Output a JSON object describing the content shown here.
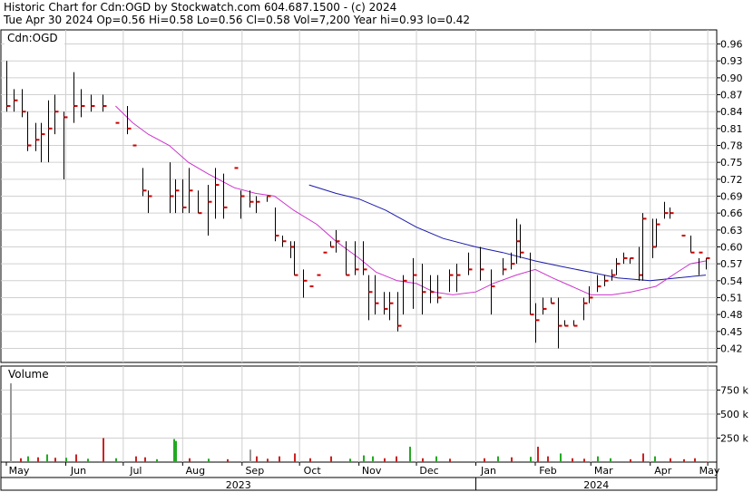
{
  "header": {
    "title": "Historic Chart for Cdn:OGD by Stockwatch.com 604.687.1500 - (c) 2024",
    "stats": "Tue Apr 30 2024  Op=0.56  Hi=0.58  Lo=0.56  Cl=0.58  Vol=7,200  Year hi=0.93  lo=0.42"
  },
  "colors": {
    "bg": "#ffffff",
    "grid": "#d0d0d0",
    "price_bar": "#000000",
    "close_tick": "#cc0000",
    "ma_short": "#cc33cc",
    "ma_long": "#1a1aaa",
    "vol_down": "#cc2222",
    "vol_up": "#22aa22",
    "vol_flat": "#999999"
  },
  "chart_data": [
    {
      "type": "ohlc",
      "symbol_label": "Cdn:OGD",
      "y_ticks": [
        0.42,
        0.45,
        0.48,
        0.51,
        0.54,
        0.57,
        0.6,
        0.63,
        0.66,
        0.69,
        0.72,
        0.75,
        0.78,
        0.81,
        0.84,
        0.87,
        0.9,
        0.93,
        0.96
      ],
      "ylim": [
        0.395,
        0.985
      ],
      "y_axis_side": "right",
      "grid": true,
      "x_month_labels": [
        "May",
        "Jun",
        "Jul",
        "Aug",
        "Sep",
        "Oct",
        "Nov",
        "Dec",
        "Jan",
        "Feb",
        "Mar",
        "Apr",
        "May"
      ],
      "x_year_labels": [
        "2023",
        "2024"
      ],
      "period": [
        "2023-05-01",
        "2024-04-30"
      ],
      "bars": [
        {
          "d": "2023-05-01",
          "h": 0.93,
          "l": 0.84,
          "c": 0.85
        },
        {
          "d": "2023-05-05",
          "h": 0.88,
          "l": 0.84,
          "c": 0.86
        },
        {
          "d": "2023-05-09",
          "h": 0.88,
          "l": 0.83,
          "c": 0.84
        },
        {
          "d": "2023-05-12",
          "h": 0.84,
          "l": 0.77,
          "c": 0.78
        },
        {
          "d": "2023-05-16",
          "h": 0.82,
          "l": 0.77,
          "c": 0.79
        },
        {
          "d": "2023-05-19",
          "h": 0.82,
          "l": 0.75,
          "c": 0.8
        },
        {
          "d": "2023-05-23",
          "h": 0.86,
          "l": 0.75,
          "c": 0.81
        },
        {
          "d": "2023-05-26",
          "h": 0.87,
          "l": 0.8,
          "c": 0.84
        },
        {
          "d": "2023-05-31",
          "h": 0.84,
          "l": 0.72,
          "c": 0.83
        },
        {
          "d": "2023-06-05",
          "h": 0.91,
          "l": 0.82,
          "c": 0.85
        },
        {
          "d": "2023-06-09",
          "h": 0.88,
          "l": 0.83,
          "c": 0.85
        },
        {
          "d": "2023-06-14",
          "h": 0.87,
          "l": 0.84,
          "c": 0.85
        },
        {
          "d": "2023-06-20",
          "h": 0.87,
          "l": 0.84,
          "c": 0.85
        },
        {
          "d": "2023-06-27",
          "h": 0.82,
          "l": 0.82,
          "c": 0.82
        },
        {
          "d": "2023-07-03",
          "h": 0.85,
          "l": 0.8,
          "c": 0.81
        },
        {
          "d": "2023-07-06",
          "h": 0.78,
          "l": 0.78,
          "c": 0.78
        },
        {
          "d": "2023-07-11",
          "h": 0.74,
          "l": 0.69,
          "c": 0.7
        },
        {
          "d": "2023-07-14",
          "h": 0.7,
          "l": 0.66,
          "c": 0.69
        },
        {
          "d": "2023-07-25",
          "h": 0.75,
          "l": 0.66,
          "c": 0.69
        },
        {
          "d": "2023-07-28",
          "h": 0.72,
          "l": 0.66,
          "c": 0.7
        },
        {
          "d": "2023-08-01",
          "h": 0.72,
          "l": 0.66,
          "c": 0.67
        },
        {
          "d": "2023-08-04",
          "h": 0.74,
          "l": 0.66,
          "c": 0.7
        },
        {
          "d": "2023-08-09",
          "h": 0.7,
          "l": 0.66,
          "c": 0.66
        },
        {
          "d": "2023-08-14",
          "h": 0.71,
          "l": 0.62,
          "c": 0.68
        },
        {
          "d": "2023-08-18",
          "h": 0.74,
          "l": 0.65,
          "c": 0.71
        },
        {
          "d": "2023-08-22",
          "h": 0.73,
          "l": 0.65,
          "c": 0.67
        },
        {
          "d": "2023-08-28",
          "h": 0.74,
          "l": 0.74,
          "c": 0.74
        },
        {
          "d": "2023-08-31",
          "h": 0.7,
          "l": 0.65,
          "c": 0.69
        },
        {
          "d": "2023-09-05",
          "h": 0.7,
          "l": 0.67,
          "c": 0.68
        },
        {
          "d": "2023-09-08",
          "h": 0.69,
          "l": 0.66,
          "c": 0.68
        },
        {
          "d": "2023-09-14",
          "h": 0.69,
          "l": 0.68,
          "c": 0.69
        },
        {
          "d": "2023-09-18",
          "h": 0.67,
          "l": 0.61,
          "c": 0.62
        },
        {
          "d": "2023-09-22",
          "h": 0.62,
          "l": 0.6,
          "c": 0.61
        },
        {
          "d": "2023-09-26",
          "h": 0.61,
          "l": 0.58,
          "c": 0.6
        },
        {
          "d": "2023-09-28",
          "h": 0.61,
          "l": 0.55,
          "c": 0.55
        },
        {
          "d": "2023-10-03",
          "h": 0.56,
          "l": 0.51,
          "c": 0.54
        },
        {
          "d": "2023-10-06",
          "h": 0.53,
          "l": 0.53,
          "c": 0.53
        },
        {
          "d": "2023-10-10",
          "h": 0.55,
          "l": 0.55,
          "c": 0.55
        },
        {
          "d": "2023-10-13",
          "h": 0.59,
          "l": 0.59,
          "c": 0.59
        },
        {
          "d": "2023-10-17",
          "h": 0.61,
          "l": 0.6,
          "c": 0.6
        },
        {
          "d": "2023-10-20",
          "h": 0.63,
          "l": 0.59,
          "c": 0.61
        },
        {
          "d": "2023-10-25",
          "h": 0.61,
          "l": 0.55,
          "c": 0.55
        },
        {
          "d": "2023-10-30",
          "h": 0.61,
          "l": 0.55,
          "c": 0.56
        },
        {
          "d": "2023-11-03",
          "h": 0.61,
          "l": 0.55,
          "c": 0.56
        },
        {
          "d": "2023-11-06",
          "h": 0.55,
          "l": 0.47,
          "c": 0.52
        },
        {
          "d": "2023-11-09",
          "h": 0.55,
          "l": 0.48,
          "c": 0.5
        },
        {
          "d": "2023-11-14",
          "h": 0.52,
          "l": 0.48,
          "c": 0.49
        },
        {
          "d": "2023-11-17",
          "h": 0.52,
          "l": 0.47,
          "c": 0.5
        },
        {
          "d": "2023-11-21",
          "h": 0.52,
          "l": 0.45,
          "c": 0.46
        },
        {
          "d": "2023-11-24",
          "h": 0.55,
          "l": 0.48,
          "c": 0.54
        },
        {
          "d": "2023-11-29",
          "h": 0.58,
          "l": 0.49,
          "c": 0.55
        },
        {
          "d": "2023-12-04",
          "h": 0.57,
          "l": 0.48,
          "c": 0.52
        },
        {
          "d": "2023-12-08",
          "h": 0.55,
          "l": 0.5,
          "c": 0.52
        },
        {
          "d": "2023-12-12",
          "h": 0.55,
          "l": 0.5,
          "c": 0.51
        },
        {
          "d": "2023-12-18",
          "h": 0.56,
          "l": 0.52,
          "c": 0.55
        },
        {
          "d": "2023-12-22",
          "h": 0.57,
          "l": 0.52,
          "c": 0.55
        },
        {
          "d": "2023-12-28",
          "h": 0.59,
          "l": 0.55,
          "c": 0.56
        },
        {
          "d": "2024-01-03",
          "h": 0.6,
          "l": 0.54,
          "c": 0.56
        },
        {
          "d": "2024-01-09",
          "h": 0.56,
          "l": 0.48,
          "c": 0.53
        },
        {
          "d": "2024-01-15",
          "h": 0.58,
          "l": 0.55,
          "c": 0.56
        },
        {
          "d": "2024-01-19",
          "h": 0.59,
          "l": 0.56,
          "c": 0.57
        },
        {
          "d": "2024-01-22",
          "h": 0.65,
          "l": 0.57,
          "c": 0.61
        },
        {
          "d": "2024-01-24",
          "h": 0.64,
          "l": 0.58,
          "c": 0.59
        },
        {
          "d": "2024-01-29",
          "h": 0.59,
          "l": 0.48,
          "c": 0.48
        },
        {
          "d": "2024-02-01",
          "h": 0.5,
          "l": 0.43,
          "c": 0.47
        },
        {
          "d": "2024-02-05",
          "h": 0.51,
          "l": 0.48,
          "c": 0.49
        },
        {
          "d": "2024-02-09",
          "h": 0.51,
          "l": 0.5,
          "c": 0.5
        },
        {
          "d": "2024-02-13",
          "h": 0.51,
          "l": 0.42,
          "c": 0.46
        },
        {
          "d": "2024-02-16",
          "h": 0.47,
          "l": 0.46,
          "c": 0.46
        },
        {
          "d": "2024-02-21",
          "h": 0.47,
          "l": 0.46,
          "c": 0.46
        },
        {
          "d": "2024-02-26",
          "h": 0.51,
          "l": 0.47,
          "c": 0.5
        },
        {
          "d": "2024-02-29",
          "h": 0.53,
          "l": 0.5,
          "c": 0.51
        },
        {
          "d": "2024-03-04",
          "h": 0.55,
          "l": 0.52,
          "c": 0.53
        },
        {
          "d": "2024-03-08",
          "h": 0.55,
          "l": 0.53,
          "c": 0.54
        },
        {
          "d": "2024-03-12",
          "h": 0.56,
          "l": 0.54,
          "c": 0.55
        },
        {
          "d": "2024-03-14",
          "h": 0.58,
          "l": 0.55,
          "c": 0.57
        },
        {
          "d": "2024-03-18",
          "h": 0.59,
          "l": 0.57,
          "c": 0.58
        },
        {
          "d": "2024-03-21",
          "h": 0.58,
          "l": 0.57,
          "c": 0.58
        },
        {
          "d": "2024-03-26",
          "h": 0.6,
          "l": 0.54,
          "c": 0.55
        },
        {
          "d": "2024-03-28",
          "h": 0.66,
          "l": 0.54,
          "c": 0.65
        },
        {
          "d": "2024-04-02",
          "h": 0.65,
          "l": 0.58,
          "c": 0.6
        },
        {
          "d": "2024-04-04",
          "h": 0.65,
          "l": 0.6,
          "c": 0.64
        },
        {
          "d": "2024-04-08",
          "h": 0.68,
          "l": 0.65,
          "c": 0.66
        },
        {
          "d": "2024-04-11",
          "h": 0.67,
          "l": 0.65,
          "c": 0.66
        },
        {
          "d": "2024-04-17",
          "h": 0.62,
          "l": 0.62,
          "c": 0.62
        },
        {
          "d": "2024-04-22",
          "h": 0.62,
          "l": 0.59,
          "c": 0.59
        },
        {
          "d": "2024-04-26",
          "h": 0.58,
          "l": 0.55,
          "c": 0.59
        },
        {
          "d": "2024-04-30",
          "h": 0.58,
          "l": 0.56,
          "c": 0.58
        }
      ],
      "ma_short": [
        {
          "d": "2023-06-27",
          "v": 0.85
        },
        {
          "d": "2023-07-06",
          "v": 0.82
        },
        {
          "d": "2023-07-14",
          "v": 0.8
        },
        {
          "d": "2023-07-25",
          "v": 0.78
        },
        {
          "d": "2023-08-04",
          "v": 0.75
        },
        {
          "d": "2023-08-14",
          "v": 0.73
        },
        {
          "d": "2023-08-28",
          "v": 0.705
        },
        {
          "d": "2023-09-08",
          "v": 0.695
        },
        {
          "d": "2023-09-18",
          "v": 0.69
        },
        {
          "d": "2023-09-28",
          "v": 0.665
        },
        {
          "d": "2023-10-10",
          "v": 0.64
        },
        {
          "d": "2023-10-20",
          "v": 0.61
        },
        {
          "d": "2023-11-01",
          "v": 0.58
        },
        {
          "d": "2023-11-10",
          "v": 0.555
        },
        {
          "d": "2023-11-21",
          "v": 0.54
        },
        {
          "d": "2023-12-01",
          "v": 0.535
        },
        {
          "d": "2023-12-10",
          "v": 0.52
        },
        {
          "d": "2023-12-20",
          "v": 0.515
        },
        {
          "d": "2024-01-01",
          "v": 0.52
        },
        {
          "d": "2024-01-10",
          "v": 0.535
        },
        {
          "d": "2024-01-22",
          "v": 0.55
        },
        {
          "d": "2024-02-01",
          "v": 0.56
        },
        {
          "d": "2024-02-10",
          "v": 0.545
        },
        {
          "d": "2024-02-20",
          "v": 0.53
        },
        {
          "d": "2024-03-01",
          "v": 0.515
        },
        {
          "d": "2024-03-12",
          "v": 0.515
        },
        {
          "d": "2024-03-22",
          "v": 0.52
        },
        {
          "d": "2024-04-04",
          "v": 0.53
        },
        {
          "d": "2024-04-15",
          "v": 0.555
        },
        {
          "d": "2024-04-22",
          "v": 0.57
        },
        {
          "d": "2024-04-30",
          "v": 0.575
        }
      ],
      "ma_long": [
        {
          "d": "2023-10-06",
          "v": 0.71
        },
        {
          "d": "2023-10-20",
          "v": 0.695
        },
        {
          "d": "2023-11-01",
          "v": 0.685
        },
        {
          "d": "2023-11-15",
          "v": 0.665
        },
        {
          "d": "2023-12-01",
          "v": 0.635
        },
        {
          "d": "2023-12-15",
          "v": 0.615
        },
        {
          "d": "2024-01-01",
          "v": 0.6
        },
        {
          "d": "2024-01-15",
          "v": 0.59
        },
        {
          "d": "2024-02-01",
          "v": 0.575
        },
        {
          "d": "2024-02-15",
          "v": 0.565
        },
        {
          "d": "2024-03-01",
          "v": 0.555
        },
        {
          "d": "2024-03-15",
          "v": 0.545
        },
        {
          "d": "2024-04-01",
          "v": 0.54
        },
        {
          "d": "2024-04-15",
          "v": 0.545
        },
        {
          "d": "2024-04-30",
          "v": 0.55
        }
      ]
    },
    {
      "type": "bar",
      "panel_label": "Volume",
      "y_ticks": [
        250000,
        500000,
        750000
      ],
      "y_tick_labels": [
        "250 k",
        "500 k",
        "750 k"
      ],
      "ylim": [
        0,
        1000000
      ],
      "volume": [
        {
          "d": "2023-05-03",
          "v": 820000,
          "k": "flat"
        },
        {
          "d": "2023-05-08",
          "v": 40000,
          "k": "down"
        },
        {
          "d": "2023-05-12",
          "v": 60000,
          "k": "up"
        },
        {
          "d": "2023-05-17",
          "v": 50000,
          "k": "down"
        },
        {
          "d": "2023-05-22",
          "v": 80000,
          "k": "up"
        },
        {
          "d": "2023-05-26",
          "v": 45000,
          "k": "down"
        },
        {
          "d": "2023-06-01",
          "v": 45000,
          "k": "up"
        },
        {
          "d": "2023-06-06",
          "v": 80000,
          "k": "down"
        },
        {
          "d": "2023-06-12",
          "v": 35000,
          "k": "up"
        },
        {
          "d": "2023-06-20",
          "v": 250000,
          "k": "down"
        },
        {
          "d": "2023-06-27",
          "v": 40000,
          "k": "up"
        },
        {
          "d": "2023-07-07",
          "v": 60000,
          "k": "down"
        },
        {
          "d": "2023-07-12",
          "v": 50000,
          "k": "down"
        },
        {
          "d": "2023-07-18",
          "v": 30000,
          "k": "up"
        },
        {
          "d": "2023-07-27",
          "v": 240000,
          "k": "up"
        },
        {
          "d": "2023-07-28",
          "v": 220000,
          "k": "up"
        },
        {
          "d": "2023-08-04",
          "v": 40000,
          "k": "down"
        },
        {
          "d": "2023-08-14",
          "v": 35000,
          "k": "up"
        },
        {
          "d": "2023-08-24",
          "v": 30000,
          "k": "down"
        },
        {
          "d": "2023-09-05",
          "v": 130000,
          "k": "flat"
        },
        {
          "d": "2023-09-08",
          "v": 60000,
          "k": "down"
        },
        {
          "d": "2023-09-14",
          "v": 35000,
          "k": "down"
        },
        {
          "d": "2023-09-20",
          "v": 60000,
          "k": "down"
        },
        {
          "d": "2023-09-28",
          "v": 90000,
          "k": "down"
        },
        {
          "d": "2023-10-06",
          "v": 40000,
          "k": "down"
        },
        {
          "d": "2023-10-17",
          "v": 60000,
          "k": "down"
        },
        {
          "d": "2023-10-27",
          "v": 35000,
          "k": "up"
        },
        {
          "d": "2023-11-03",
          "v": 70000,
          "k": "up"
        },
        {
          "d": "2023-11-08",
          "v": 60000,
          "k": "up"
        },
        {
          "d": "2023-11-14",
          "v": 40000,
          "k": "down"
        },
        {
          "d": "2023-11-20",
          "v": 60000,
          "k": "down"
        },
        {
          "d": "2023-11-27",
          "v": 160000,
          "k": "up"
        },
        {
          "d": "2023-12-04",
          "v": 40000,
          "k": "down"
        },
        {
          "d": "2023-12-11",
          "v": 60000,
          "k": "up"
        },
        {
          "d": "2023-12-18",
          "v": 35000,
          "k": "down"
        },
        {
          "d": "2024-01-05",
          "v": 40000,
          "k": "down"
        },
        {
          "d": "2024-01-12",
          "v": 60000,
          "k": "up"
        },
        {
          "d": "2024-01-19",
          "v": 50000,
          "k": "down"
        },
        {
          "d": "2024-01-29",
          "v": 55000,
          "k": "up"
        },
        {
          "d": "2024-02-02",
          "v": 160000,
          "k": "down"
        },
        {
          "d": "2024-02-07",
          "v": 60000,
          "k": "down"
        },
        {
          "d": "2024-02-14",
          "v": 90000,
          "k": "up"
        },
        {
          "d": "2024-02-20",
          "v": 40000,
          "k": "down"
        },
        {
          "d": "2024-02-26",
          "v": 35000,
          "k": "down"
        },
        {
          "d": "2024-03-04",
          "v": 60000,
          "k": "up"
        },
        {
          "d": "2024-03-11",
          "v": 40000,
          "k": "up"
        },
        {
          "d": "2024-03-21",
          "v": 30000,
          "k": "down"
        },
        {
          "d": "2024-03-28",
          "v": 90000,
          "k": "down"
        },
        {
          "d": "2024-04-03",
          "v": 60000,
          "k": "up"
        },
        {
          "d": "2024-04-11",
          "v": 40000,
          "k": "down"
        },
        {
          "d": "2024-04-18",
          "v": 30000,
          "k": "down"
        },
        {
          "d": "2024-04-24",
          "v": 40000,
          "k": "down"
        },
        {
          "d": "2024-04-30",
          "v": 7200,
          "k": "down"
        }
      ]
    }
  ]
}
